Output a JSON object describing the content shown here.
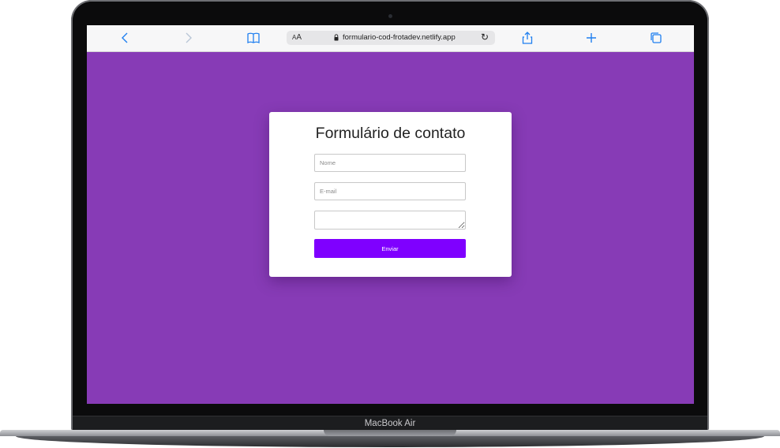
{
  "browser": {
    "url": "formulario-cod-frotadev.netlify.app",
    "reader_label_small": "A",
    "reader_label_big": "A",
    "icons": {
      "back": "chevron-left-icon",
      "forward": "chevron-right-icon",
      "bookmarks": "book-icon",
      "lock": "lock-icon",
      "reload": "reload-icon",
      "share": "share-icon",
      "new_tab": "plus-icon",
      "tabs": "tabs-icon"
    },
    "accent_color": "#1f7ff0"
  },
  "page": {
    "background_color": "#873bb6",
    "form": {
      "title": "Formulário de contato",
      "name_placeholder": "Nome",
      "email_placeholder": "E-mail",
      "message_value": "",
      "submit_label": "Enviar",
      "submit_color": "#7f00ff"
    }
  },
  "device": {
    "brand_label": "MacBook Air"
  }
}
